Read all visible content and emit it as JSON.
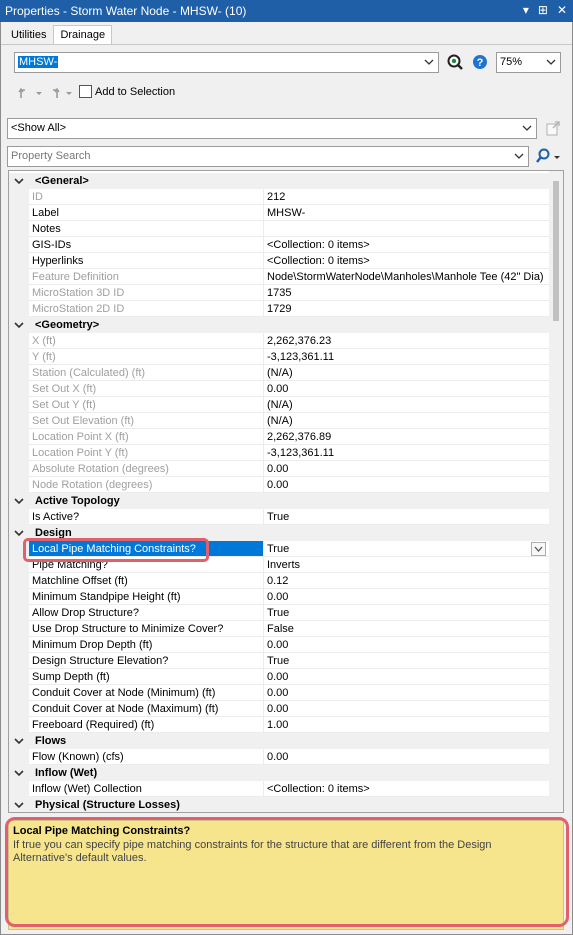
{
  "window": {
    "title": "Properties - Storm Water Node - MHSW- (10)",
    "controls": [
      "▾",
      "⊞",
      "✕"
    ]
  },
  "tabs": [
    "Utilities",
    "Drainage"
  ],
  "element_select": {
    "value": "MHSW-"
  },
  "zoom": "75%",
  "add_to_selection": "Add to Selection",
  "filter": {
    "value": "<Show All>"
  },
  "search": {
    "placeholder": "Property Search"
  },
  "grid": {
    "general": {
      "label": "<General>",
      "rows": [
        {
          "name": "ID",
          "value": "212"
        },
        {
          "name": "Label",
          "value": "MHSW-"
        },
        {
          "name": "Notes",
          "value": ""
        },
        {
          "name": "GIS-IDs",
          "value": "<Collection: 0 items>"
        },
        {
          "name": "Hyperlinks",
          "value": "<Collection: 0 items>"
        },
        {
          "name": "Feature Definition",
          "value": "Node\\StormWaterNode\\Manholes\\Manhole Tee (42\" Dia)"
        },
        {
          "name": "MicroStation 3D ID",
          "value": "1735"
        },
        {
          "name": "MicroStation 2D ID",
          "value": "1729"
        }
      ]
    },
    "geometry": {
      "label": "<Geometry>",
      "rows": [
        {
          "name": "X (ft)",
          "value": "2,262,376.23"
        },
        {
          "name": "Y (ft)",
          "value": "-3,123,361.11"
        },
        {
          "name": "Station (Calculated) (ft)",
          "value": "(N/A)"
        },
        {
          "name": "Set Out X (ft)",
          "value": "0.00"
        },
        {
          "name": "Set Out Y (ft)",
          "value": "(N/A)"
        },
        {
          "name": "Set Out Elevation (ft)",
          "value": "(N/A)"
        },
        {
          "name": "Location Point X (ft)",
          "value": "2,262,376.89"
        },
        {
          "name": "Location Point Y (ft)",
          "value": "-3,123,361.11"
        },
        {
          "name": "Absolute Rotation (degrees)",
          "value": "0.00"
        },
        {
          "name": "Node Rotation (degrees)",
          "value": "0.00"
        }
      ]
    },
    "active_topology": {
      "label": "Active Topology",
      "rows": [
        {
          "name": "Is Active?",
          "value": "True"
        }
      ]
    },
    "design": {
      "label": "Design",
      "rows": [
        {
          "name": "Local Pipe Matching Constraints?",
          "value": "True"
        },
        {
          "name": "Pipe Matching?",
          "value": "Inverts"
        },
        {
          "name": "Matchline Offset (ft)",
          "value": "0.12"
        },
        {
          "name": "Minimum Standpipe Height (ft)",
          "value": "0.00"
        },
        {
          "name": "Allow Drop Structure?",
          "value": "True"
        },
        {
          "name": "Use Drop Structure to Minimize Cover?",
          "value": "False"
        },
        {
          "name": "Minimum Drop Depth (ft)",
          "value": "0.00"
        },
        {
          "name": "Design Structure Elevation?",
          "value": "True"
        },
        {
          "name": "Sump Depth (ft)",
          "value": "0.00"
        },
        {
          "name": "Conduit Cover at Node (Minimum) (ft)",
          "value": "0.00"
        },
        {
          "name": "Conduit Cover at Node (Maximum) (ft)",
          "value": "0.00"
        },
        {
          "name": "Freeboard (Required) (ft)",
          "value": "1.00"
        }
      ]
    },
    "flows": {
      "label": "Flows",
      "rows": [
        {
          "name": "Flow (Known) (cfs)",
          "value": "0.00"
        }
      ]
    },
    "inflow": {
      "label": "Inflow (Wet)",
      "rows": [
        {
          "name": "Inflow (Wet) Collection",
          "value": "<Collection: 0 items>"
        }
      ]
    },
    "physical": {
      "label": "Physical (Structure Losses)"
    }
  },
  "description": {
    "title": "Local Pipe Matching Constraints?",
    "text": "If true you can specify pipe matching constraints for the structure that are different from the Design Alternative's default values."
  }
}
